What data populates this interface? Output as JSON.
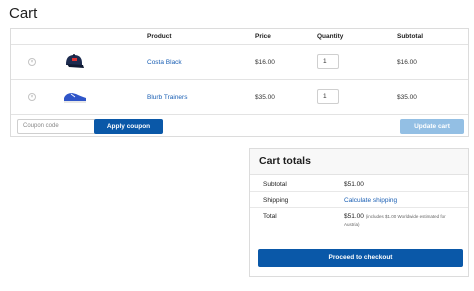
{
  "page": {
    "title": "Cart"
  },
  "cart": {
    "columns": {
      "product": "Product",
      "price": "Price",
      "quantity": "Quantity",
      "subtotal": "Subtotal"
    },
    "items": [
      {
        "name": "Costa Black",
        "price": "$16.00",
        "quantity": "1",
        "subtotal": "$16.00",
        "image_icon": "cap-icon"
      },
      {
        "name": "Blurb Trainers",
        "price": "$35.00",
        "quantity": "1",
        "subtotal": "$35.00",
        "image_icon": "sneaker-icon"
      }
    ],
    "remove_symbol": "×",
    "coupon_placeholder": "Coupon code",
    "apply_label": "Apply coupon",
    "update_label": "Update cart"
  },
  "totals": {
    "title": "Cart totals",
    "subtotal_label": "Subtotal",
    "subtotal_value": "$51.00",
    "shipping_label": "Shipping",
    "shipping_link": "Calculate shipping",
    "total_label": "Total",
    "total_value": "$51.00",
    "total_note": "(includes $1.00 Worldwide estimated for Austria)",
    "checkout_label": "Proceed to checkout"
  },
  "colors": {
    "accent": "#0a58a8",
    "link": "#1a5fb4",
    "disabled": "#93bfe4"
  }
}
